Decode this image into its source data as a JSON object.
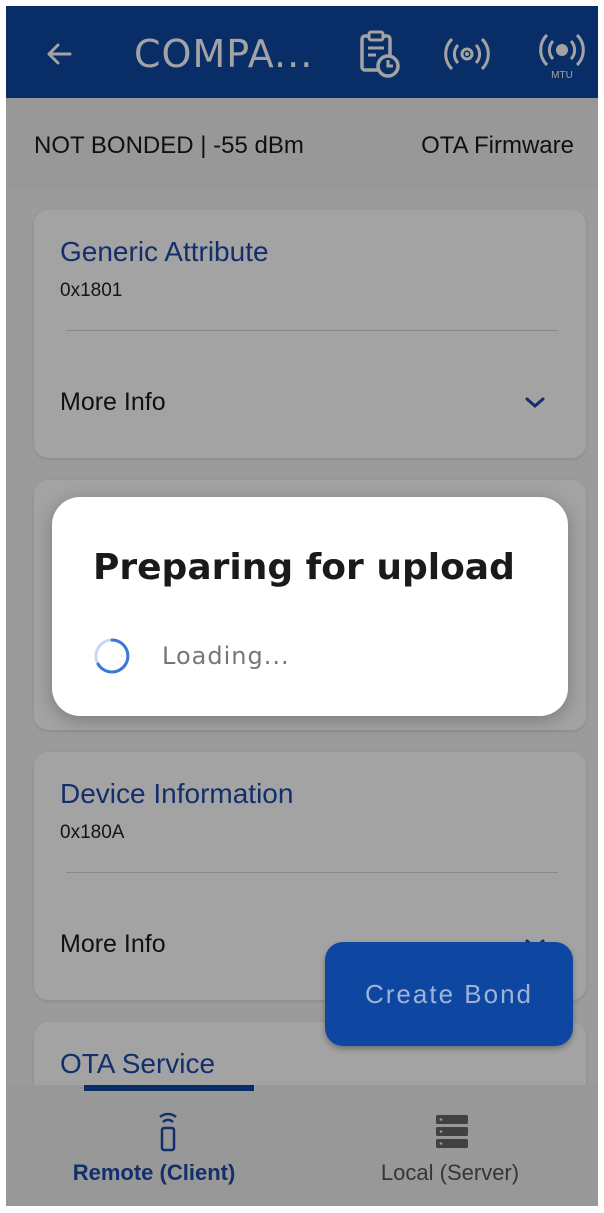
{
  "app_bar": {
    "title": "COMPA...",
    "back_icon": "arrow-back-icon",
    "log_icon": "clipboard-clock-icon",
    "rssi_icon": "signal-broadcast-icon",
    "mtu_icon": "mtu-broadcast-icon",
    "mtu_label": "MTU",
    "background": "#0d47a1"
  },
  "status_bar": {
    "bond_status": "NOT BONDED | -55 dBm",
    "ota_label": "OTA Firmware"
  },
  "services": [
    {
      "name": "Generic Attribute",
      "uuid": "0x1801",
      "more_label": "More Info"
    },
    {
      "name": "",
      "uuid": "",
      "more_label": ""
    },
    {
      "name": "Device Information",
      "uuid": "0x180A",
      "more_label": "More Info"
    },
    {
      "name": "OTA Service",
      "uuid": "",
      "more_label": ""
    }
  ],
  "fab": {
    "label": "Create Bond"
  },
  "dialog": {
    "title": "Preparing for upload",
    "message": "Loading..."
  },
  "bottom_nav": {
    "tabs": [
      {
        "label": "Remote (Client)",
        "icon": "remote-icon",
        "active": true
      },
      {
        "label": "Local (Server)",
        "icon": "server-icon",
        "active": false
      }
    ]
  },
  "colors": {
    "primary": "#0d47a1",
    "service_name": "#1f4aa8",
    "spinner": "#3b78d8"
  }
}
